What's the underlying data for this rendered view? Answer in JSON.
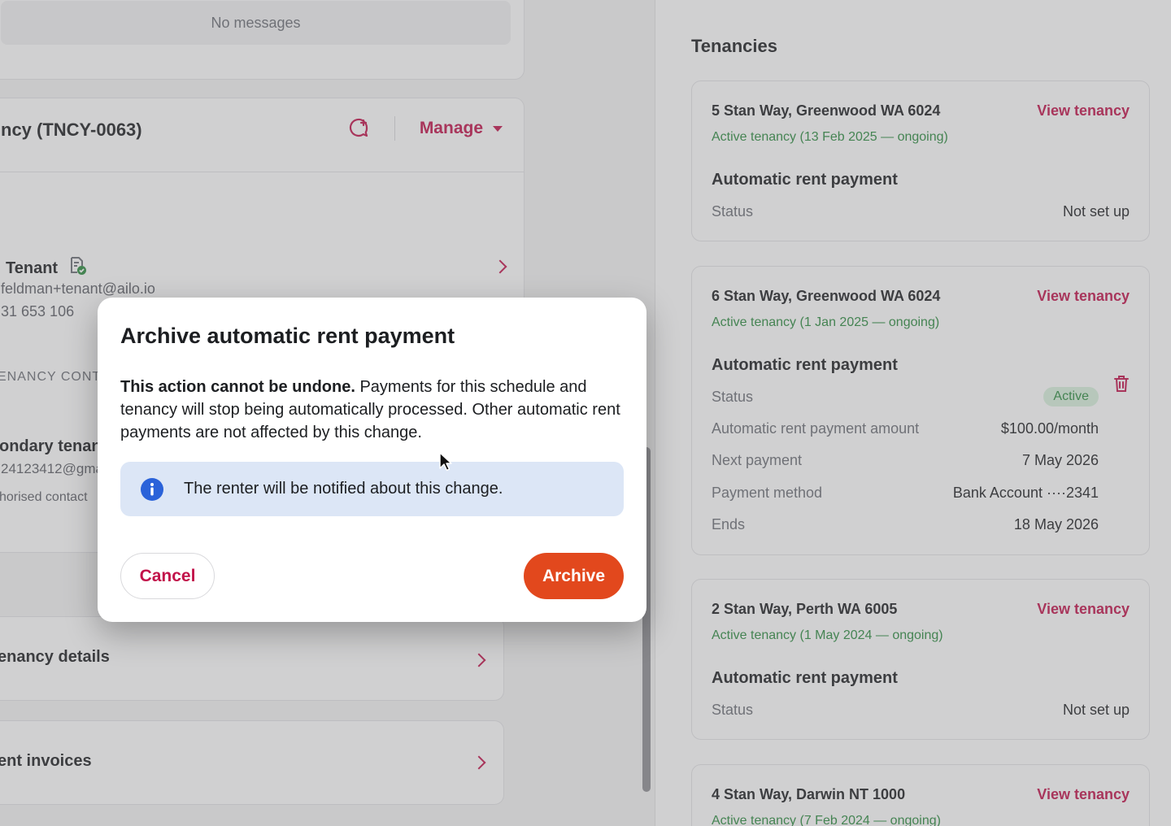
{
  "messages": {
    "empty_text": "No messages"
  },
  "tenancy_panel": {
    "title": "ncy (TNCY-0063)",
    "manage_label": "Manage",
    "tenant": {
      "name": "Tenant",
      "email": "feldman+tenant@ailo.io",
      "phone": "31 653 106"
    },
    "contacts_section_label": "ENANCY CONT",
    "secondary_tenant": {
      "name": "ondary tenan",
      "email": "24123412@gma",
      "role": "horised contact"
    },
    "rows": [
      {
        "label": "enancy details"
      },
      {
        "label": "ent invoices"
      }
    ]
  },
  "tenancies": {
    "heading": "Tenancies",
    "view_label": "View tenancy",
    "arp_heading": "Automatic rent payment",
    "items": [
      {
        "address": "5 Stan Way, Greenwood WA 6024",
        "status": "Active tenancy (13 Feb 2025 — ongoing)",
        "arp_status_key": "Status",
        "arp_status_value": "Not set up"
      },
      {
        "address": "6 Stan Way, Greenwood WA 6024",
        "status": "Active tenancy (1 Jan 2025 — ongoing)",
        "arp_status_key": "Status",
        "arp_status_value": "Active",
        "details": [
          {
            "key": "Automatic rent payment amount",
            "value": "$100.00/month"
          },
          {
            "key": "Next payment",
            "value": "7 May 2026"
          },
          {
            "key": "Payment method",
            "value": "Bank Account ····2341"
          },
          {
            "key": "Ends",
            "value": "18 May 2026"
          }
        ]
      },
      {
        "address": "2 Stan Way, Perth WA 6005",
        "status": "Active tenancy (1 May 2024 — ongoing)",
        "arp_status_key": "Status",
        "arp_status_value": "Not set up"
      },
      {
        "address": "4 Stan Way, Darwin NT 1000",
        "status": "Active tenancy (7 Feb 2024 — ongoing)"
      }
    ]
  },
  "modal": {
    "title": "Archive automatic rent payment",
    "body_bold": "This action cannot be undone.",
    "body_rest": " Payments for this schedule and tenancy will stop being automatically processed. Other automatic rent payments are not affected by this change.",
    "info_text": "The renter will be notified about this change.",
    "cancel_label": "Cancel",
    "archive_label": "Archive"
  },
  "colors": {
    "accent": "#c2124a",
    "archive_button": "#e2481d",
    "active_green": "#2a8a3e",
    "info_banner": "#dce6f6",
    "info_icon": "#2a62d9"
  },
  "icons": [
    "chat-add-icon",
    "chevron-down-icon",
    "verified-document-icon",
    "chevron-right-icon",
    "trash-icon",
    "info-icon",
    "mouse-cursor-icon"
  ]
}
